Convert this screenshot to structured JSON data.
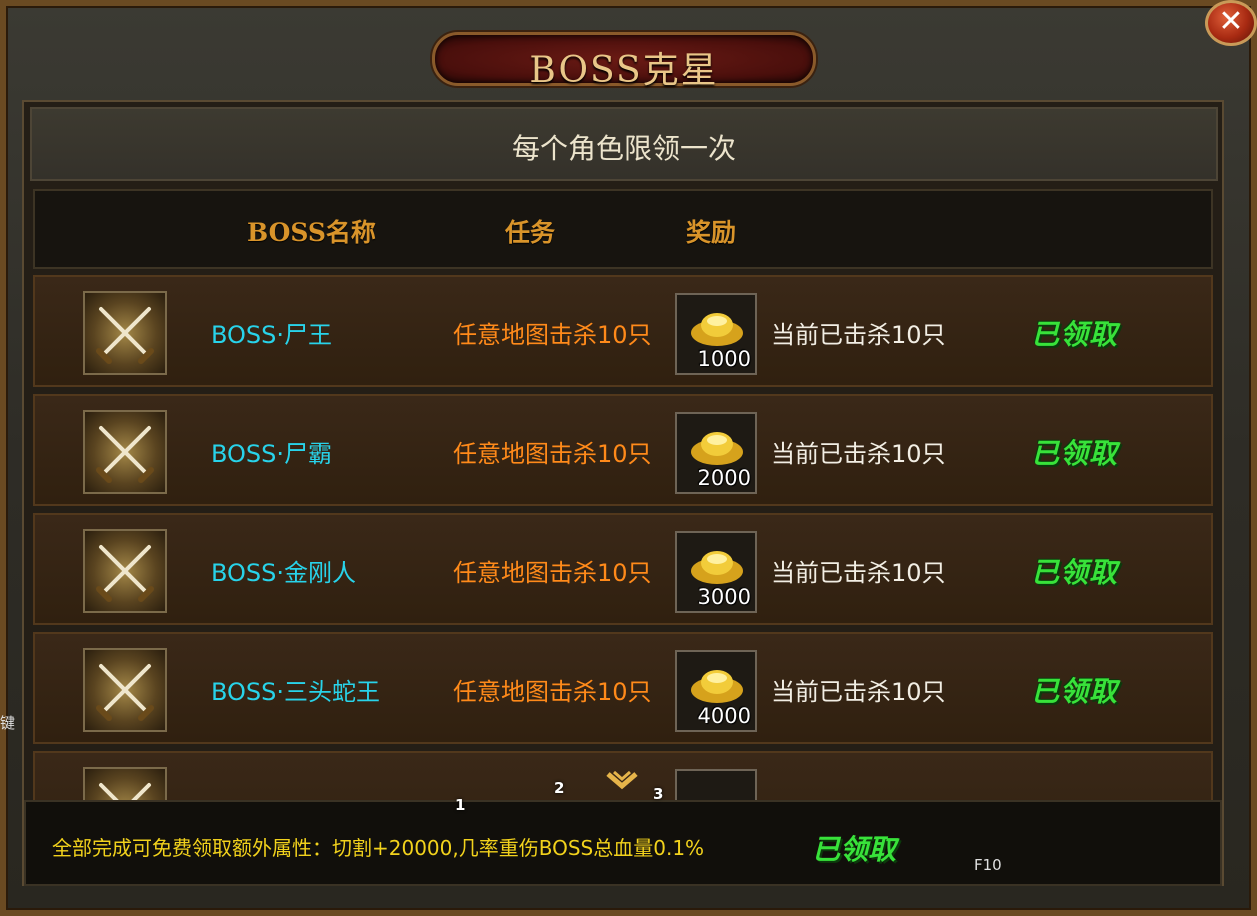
{
  "window": {
    "title": "BOSS克星",
    "close_symbol": "✕",
    "notice": "每个角色限领一次"
  },
  "header": {
    "col_name": "BOSS名称",
    "col_task": "任务",
    "col_reward": "奖励"
  },
  "rows": [
    {
      "name": "BOSS·尸王",
      "task": "任意地图击杀10只",
      "reward_amount": "1000",
      "progress": "当前已击杀10只",
      "status": "已领取",
      "icon": "crossed-swords-icon",
      "reward_icon": "gold-ingot-icon"
    },
    {
      "name": "BOSS·尸霸",
      "task": "任意地图击杀10只",
      "reward_amount": "2000",
      "progress": "当前已击杀10只",
      "status": "已领取",
      "icon": "crossed-swords-icon",
      "reward_icon": "gold-ingot-icon"
    },
    {
      "name": "BOSS·金刚人",
      "task": "任意地图击杀10只",
      "reward_amount": "3000",
      "progress": "当前已击杀10只",
      "status": "已领取",
      "icon": "crossed-swords-icon",
      "reward_icon": "gold-ingot-icon"
    },
    {
      "name": "BOSS·三头蛇王",
      "task": "任意地图击杀10只",
      "reward_amount": "4000",
      "progress": "当前已击杀10只",
      "status": "已领取",
      "icon": "crossed-swords-icon",
      "reward_icon": "gold-ingot-icon"
    }
  ],
  "bottom": {
    "text": "全部完成可免费领取额外属性：切割+20000,几率重伤BOSS总血量0.1%",
    "status": "已领取",
    "hotkey": "F10"
  },
  "overlay": {
    "marker1": "1",
    "marker2": "2",
    "marker3": "3",
    "side_text": "键"
  },
  "colors": {
    "boss_name": "#28d3ea",
    "task": "#ff8a1a",
    "claimed": "#38e23a",
    "header": "#d9942a",
    "bottom_text": "#f2d21c"
  }
}
